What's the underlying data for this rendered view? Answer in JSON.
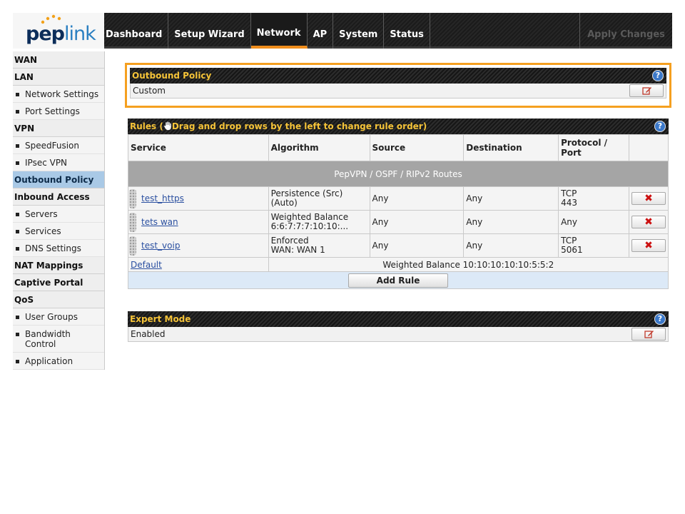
{
  "header": {
    "logo": {
      "pep": "pep",
      "link": "link"
    },
    "nav": [
      "Dashboard",
      "Setup Wizard",
      "Network",
      "AP",
      "System",
      "Status"
    ],
    "active_nav": "Network",
    "apply_label": "Apply Changes"
  },
  "sidebar": {
    "items": [
      {
        "kind": "head",
        "label": "WAN"
      },
      {
        "kind": "head",
        "label": "LAN"
      },
      {
        "kind": "item",
        "label": "Network Settings"
      },
      {
        "kind": "item",
        "label": "Port Settings"
      },
      {
        "kind": "head",
        "label": "VPN"
      },
      {
        "kind": "item",
        "label": "SpeedFusion"
      },
      {
        "kind": "item",
        "label": "IPsec VPN"
      },
      {
        "kind": "head",
        "label": "Outbound Policy",
        "active": true
      },
      {
        "kind": "head",
        "label": "Inbound Access"
      },
      {
        "kind": "item",
        "label": "Servers"
      },
      {
        "kind": "item",
        "label": "Services"
      },
      {
        "kind": "item",
        "label": "DNS Settings"
      },
      {
        "kind": "head",
        "label": "NAT Mappings"
      },
      {
        "kind": "head",
        "label": "Captive Portal"
      },
      {
        "kind": "head",
        "label": "QoS"
      },
      {
        "kind": "item",
        "label": "User Groups"
      },
      {
        "kind": "item",
        "label": "Bandwidth Control"
      },
      {
        "kind": "item",
        "label": "Application"
      }
    ]
  },
  "outbound_policy": {
    "title": "Outbound Policy",
    "value": "Custom"
  },
  "rules": {
    "title": "Rules (",
    "title_hint": "Drag and drop rows by the left to change rule order)",
    "columns": [
      "Service",
      "Algorithm",
      "Source",
      "Destination",
      "Protocol / Port",
      ""
    ],
    "group_label": "PepVPN / OSPF / RIPv2 Routes",
    "rows": [
      {
        "service": "test_https",
        "algorithm_line1": "Persistence (Src)",
        "algorithm_line2": "(Auto)",
        "source": "Any",
        "destination": "Any",
        "protocol_line1": "TCP",
        "protocol_line2": "443"
      },
      {
        "service": "tets wan",
        "algorithm_line1": "Weighted Balance",
        "algorithm_line2": "6:6:7:7:7:10:10:...",
        "source": "Any",
        "destination": "Any",
        "protocol_line1": "Any",
        "protocol_line2": ""
      },
      {
        "service": "test_voip",
        "algorithm_line1": "Enforced",
        "algorithm_line2": "WAN: WAN 1",
        "source": "Any",
        "destination": "Any",
        "protocol_line1": "TCP",
        "protocol_line2": "5061"
      }
    ],
    "default_label": "Default",
    "default_value": "Weighted Balance 10:10:10:10:10:5:5:2",
    "add_rule_label": "Add Rule"
  },
  "expert_mode": {
    "title": "Expert Mode",
    "value": "Enabled"
  },
  "help_glyph": "?",
  "colors": {
    "accent": "#ef8d1c",
    "highlight_border": "#f5a020",
    "title_text": "#f5c338",
    "active_sidebar": "#a9c9e6"
  }
}
